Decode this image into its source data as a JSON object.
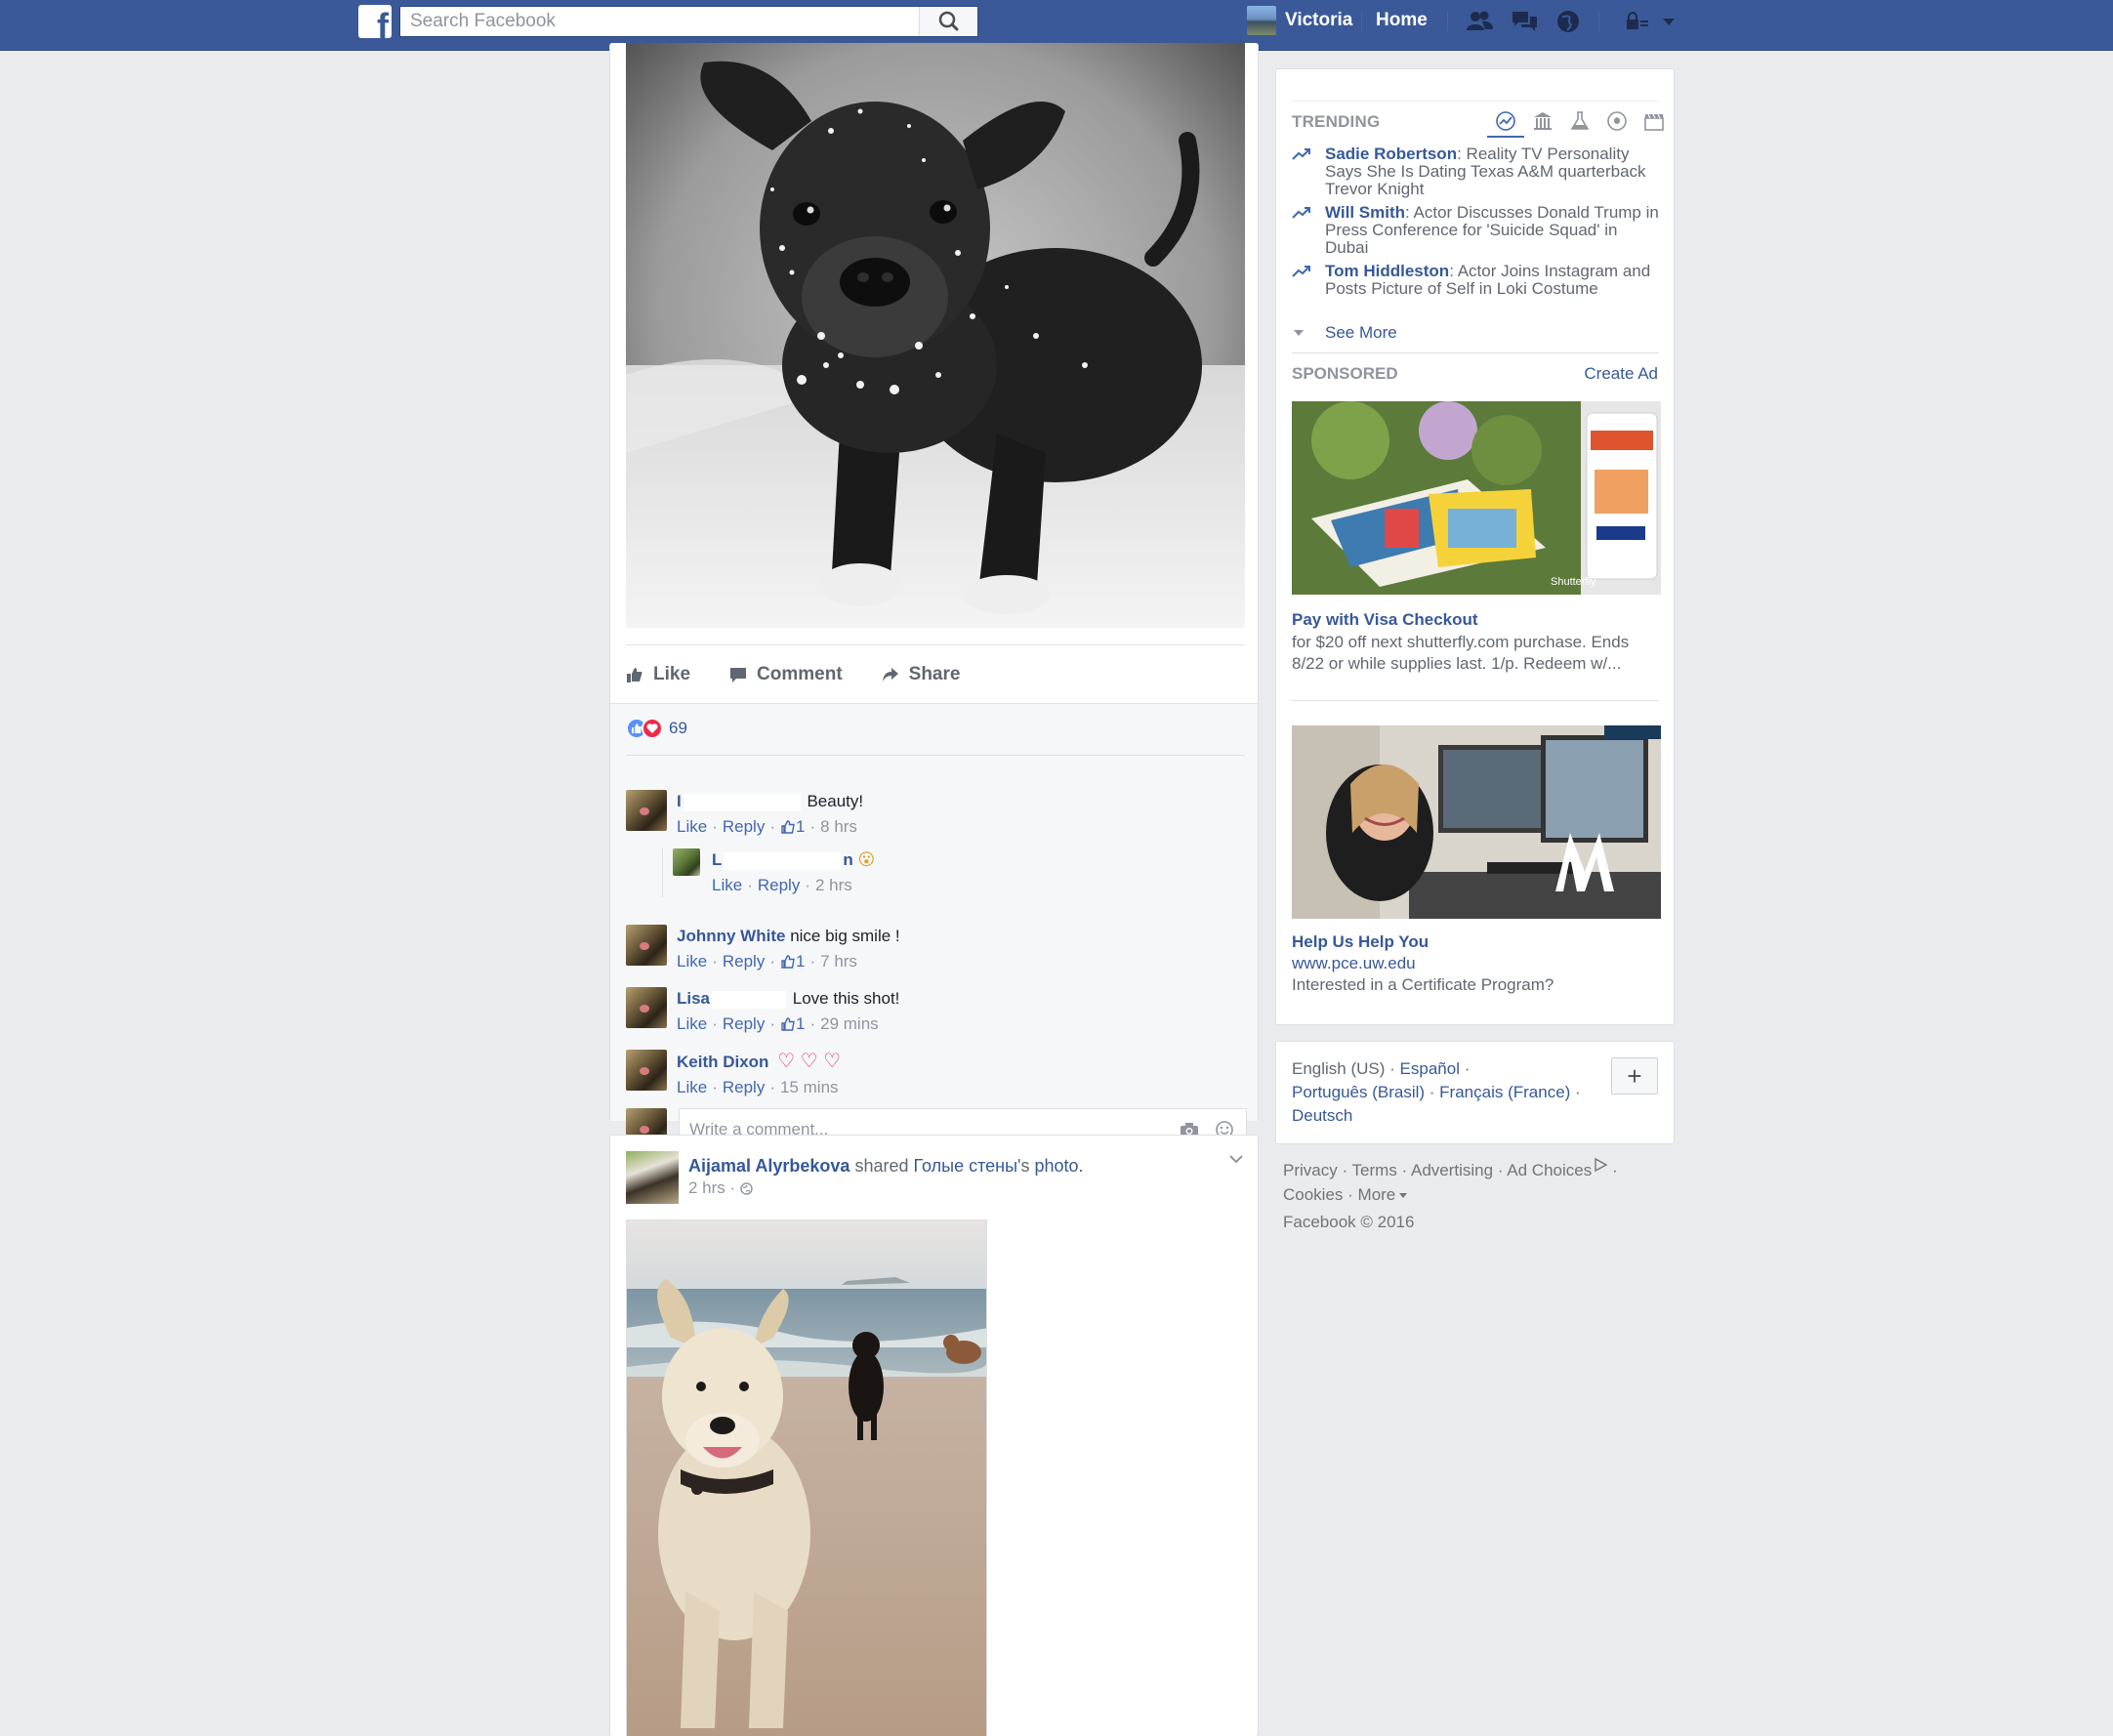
{
  "topbar": {
    "logo": "f",
    "search_placeholder": "Search Facebook",
    "profile_name": "Victoria",
    "home_label": "Home",
    "icons": [
      "friend-requests-icon",
      "messages-icon",
      "notifications-icon",
      "privacy-shortcuts-icon",
      "account-menu-icon"
    ]
  },
  "post1": {
    "actions": {
      "like": "Like",
      "comment": "Comment",
      "share": "Share"
    },
    "reaction_count": "69",
    "comments": [
      {
        "name": "I",
        "text": "Beauty!",
        "like": "Like",
        "reply": "Reply",
        "likes": "1",
        "time": "8 hrs"
      },
      {
        "name": "L",
        "name_tail": "n",
        "text": "😮",
        "like": "Like",
        "reply": "Reply",
        "time": "2 hrs"
      },
      {
        "name": "Johnny White",
        "text": "nice big smile !",
        "like": "Like",
        "reply": "Reply",
        "likes": "1",
        "time": "7 hrs"
      },
      {
        "name": "Lisa",
        "text": "Love this shot!",
        "like": "Like",
        "reply": "Reply",
        "likes": "1",
        "time": "29 mins"
      },
      {
        "name": "Keith Dixon",
        "text": "♡ ♡ ♡",
        "like": "Like",
        "reply": "Reply",
        "time": "15 mins"
      }
    ],
    "write_placeholder": "Write a comment..."
  },
  "post2": {
    "author": "Aijamal Alyrbekova",
    "shared": "shared",
    "page": "Голые стены",
    "page_suffix": "'s",
    "photo_word": "photo.",
    "time": "2 hrs ·"
  },
  "trending": {
    "label": "TRENDING",
    "items": [
      {
        "name": "Sadie Robertson",
        "desc": ": Reality TV Personality Says She Is Dating Texas A&M quarterback Trevor Knight"
      },
      {
        "name": "Will Smith",
        "desc": ": Actor Discusses Donald Trump in Press Conference for 'Suicide Squad' in Dubai"
      },
      {
        "name": "Tom Hiddleston",
        "desc": ": Actor Joins Instagram and Posts Picture of Self in Loki Costume"
      }
    ],
    "see_more": "See More"
  },
  "sponsored": {
    "label": "SPONSORED",
    "create_ad": "Create Ad",
    "ad1": {
      "title": "Pay with Visa Checkout",
      "desc": "for $20 off next shutterfly.com purchase. Ends 8/22 or while supplies last. 1/p. Redeem w/...",
      "img_text": "Shutterfly"
    },
    "ad2": {
      "title": "Help Us Help You",
      "url": "www.pce.uw.edu",
      "desc": "Interested in a Certificate Program?"
    }
  },
  "languages": {
    "current": "English (US)",
    "others": [
      "Español",
      "Português (Brasil)",
      "Français (France)",
      "Deutsch"
    ],
    "plus": "+"
  },
  "footer": {
    "links": [
      "Privacy",
      "Terms",
      "Advertising",
      "Ad Choices",
      "Cookies",
      "More"
    ],
    "copyright": "Facebook © 2016"
  },
  "colors": {
    "brand": "#3b5998",
    "link": "#365899",
    "background": "#e9ebee"
  }
}
